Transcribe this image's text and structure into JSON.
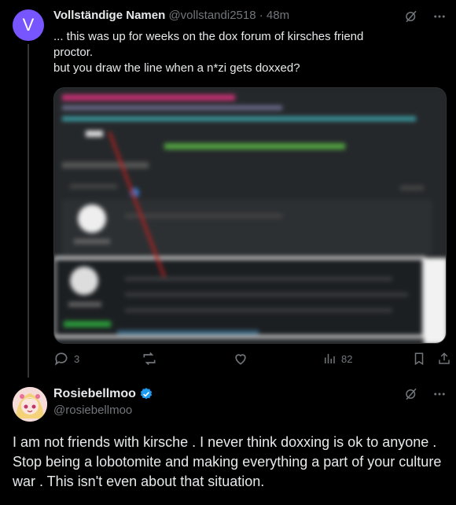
{
  "tweet1": {
    "avatar_letter": "V",
    "author_name": "Vollständige Namen",
    "handle": "@vollstandi2518",
    "separator": "·",
    "time": "48m",
    "text_lines": [
      "... this was up for weeks on the dox forum of kirsches friend",
      "proctor.",
      "but you draw the line when a n*zi gets doxxed?"
    ],
    "reply_count": "3",
    "retweet_count": "",
    "like_count": "",
    "view_count": "82"
  },
  "tweet2": {
    "author_name": "Rosiebellmoo",
    "handle": "@rosiebellmoo",
    "text": "I am not friends with kirsche . I never think doxxing is ok to anyone . Stop being a lobotomite and making everything a part of your culture war . This isn't even about that situation."
  },
  "colors": {
    "background": "#000000",
    "text": "#e7e9ea",
    "muted": "#71767b",
    "avatar_v": "#7856ff",
    "verified": "#1d9bf0"
  }
}
